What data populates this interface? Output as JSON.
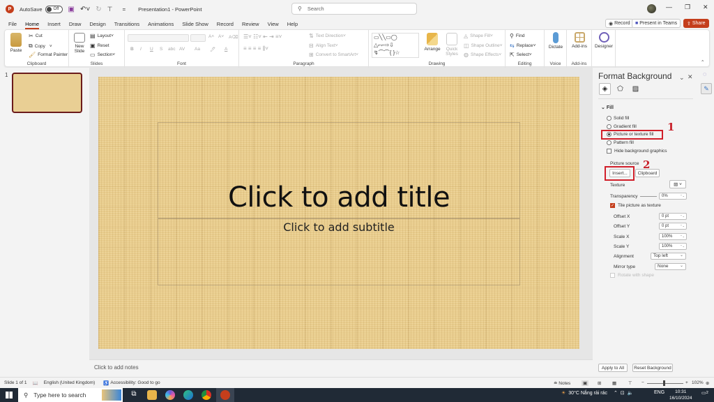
{
  "titlebar": {
    "autosave_label": "AutoSave",
    "autosave_state": "Off",
    "doc_title": "Presentation1  -  PowerPoint",
    "search_placeholder": "Search",
    "minimize": "—",
    "restore": "❐",
    "close": "✕"
  },
  "tabs": [
    "File",
    "Home",
    "Insert",
    "Draw",
    "Design",
    "Transitions",
    "Animations",
    "Slide Show",
    "Record",
    "Review",
    "View",
    "Help"
  ],
  "active_tab": "Home",
  "header_buttons": {
    "comments": "💬",
    "record": "Record",
    "present_teams": "Present in Teams",
    "share": "Share"
  },
  "ribbon": {
    "clipboard": {
      "label": "Clipboard",
      "paste": "Paste",
      "cut": "Cut",
      "copy": "Copy",
      "format_painter": "Format Painter"
    },
    "slides": {
      "label": "Slides",
      "new_slide": "New Slide",
      "layout": "Layout",
      "reset": "Reset",
      "section": "Section"
    },
    "font": {
      "label": "Font",
      "bold": "B",
      "italic": "I",
      "underline": "U",
      "strike": "S",
      "shadow": "abc",
      "spacing": "AV",
      "case": "Aa",
      "highlight": "🖊",
      "color": "A",
      "grow": "A˄",
      "shrink": "A˅",
      "clear": "A⌫"
    },
    "paragraph": {
      "label": "Paragraph",
      "text_direction": "Text Direction",
      "align_text": "Align Text",
      "convert_smartart": "Convert to SmartArt"
    },
    "drawing": {
      "label": "Drawing",
      "arrange": "Arrange",
      "quick_styles": "Quick Styles",
      "shape_fill": "Shape Fill",
      "shape_outline": "Shape Outline",
      "shape_effects": "Shape Effects"
    },
    "editing": {
      "label": "Editing",
      "find": "Find",
      "replace": "Replace",
      "select": "Select"
    },
    "voice": {
      "label": "Voice",
      "dictate": "Dictate"
    },
    "addins": {
      "label": "Add-ins",
      "addins": "Add-ins"
    },
    "designer": {
      "label": "Designer"
    }
  },
  "thumbnails": [
    {
      "number": "1"
    }
  ],
  "slide": {
    "title": "Click to add title",
    "subtitle": "Click to add subtitle"
  },
  "notes_placeholder": "Click to add notes",
  "format_panel": {
    "title": "Format Background",
    "section_fill": "Fill",
    "options": [
      {
        "label": "Solid fill",
        "selected": false
      },
      {
        "label": "Gradient fill",
        "selected": false
      },
      {
        "label": "Picture or texture fill",
        "selected": true
      },
      {
        "label": "Pattern fill",
        "selected": false
      }
    ],
    "hide_bg_graphics": "Hide background graphics",
    "picture_source": "Picture source",
    "insert_btn": "Insert...",
    "clipboard_btn": "Clipboard",
    "texture": "Texture",
    "transparency": "Transparency",
    "transparency_value": "0%",
    "tile": "Tile picture as texture",
    "offset_x": "Offset X",
    "offset_x_value": "0 pt",
    "offset_y": "Offset Y",
    "offset_y_value": "0 pt",
    "scale_x": "Scale X",
    "scale_x_value": "100%",
    "scale_y": "Scale Y",
    "scale_y_value": "100%",
    "alignment": "Alignment",
    "alignment_value": "Top left",
    "mirror_type": "Mirror type",
    "mirror_value": "None",
    "rotate_with_shape": "Rotate with shape",
    "apply_all": "Apply to All",
    "reset_bg": "Reset Background"
  },
  "annotations": {
    "step1": "1",
    "step2": "2"
  },
  "statusbar": {
    "slide_count": "Slide 1 of 1",
    "language": "English (United Kingdom)",
    "accessibility": "Accessibility: Good to go",
    "notes": "Notes",
    "zoom": "102%"
  },
  "taskbar": {
    "search_placeholder": "Type here to search",
    "weather": "30°C  Nắng rải rác",
    "lang": "ENG",
    "time": "10:31",
    "date": "16/10/2024",
    "notif_count": "2"
  },
  "colors": {
    "accent": "#c43e1c",
    "annotation": "#d11f2a",
    "slide_bg": "#e8cc8c"
  }
}
